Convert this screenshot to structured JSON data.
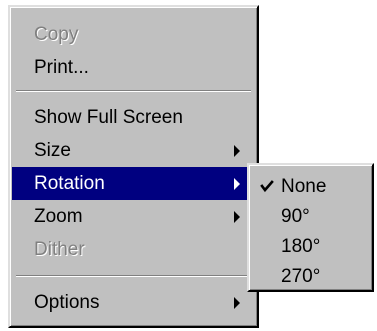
{
  "main_menu": {
    "items": [
      {
        "label": "Copy",
        "enabled": false
      },
      {
        "label": "Print...",
        "enabled": true
      },
      {
        "label": "Show Full Screen",
        "enabled": true
      },
      {
        "label": "Size",
        "enabled": true,
        "has_submenu": true
      },
      {
        "label": "Rotation",
        "enabled": true,
        "has_submenu": true,
        "highlighted": true
      },
      {
        "label": "Zoom",
        "enabled": true,
        "has_submenu": true
      },
      {
        "label": "Dither",
        "enabled": false
      },
      {
        "label": "Options",
        "enabled": true,
        "has_submenu": true
      }
    ]
  },
  "rotation_submenu": {
    "items": [
      {
        "label": "None",
        "checked": true
      },
      {
        "label": "90°",
        "checked": false
      },
      {
        "label": "180°",
        "checked": false
      },
      {
        "label": "270°",
        "checked": false
      }
    ]
  },
  "colors": {
    "menu_background": "#c0c0c0",
    "highlight": "#000080",
    "highlight_text": "#ffffff",
    "disabled_text": "#808080"
  },
  "icons": {
    "submenu_arrow": "right-triangle",
    "check": "check-mark"
  }
}
